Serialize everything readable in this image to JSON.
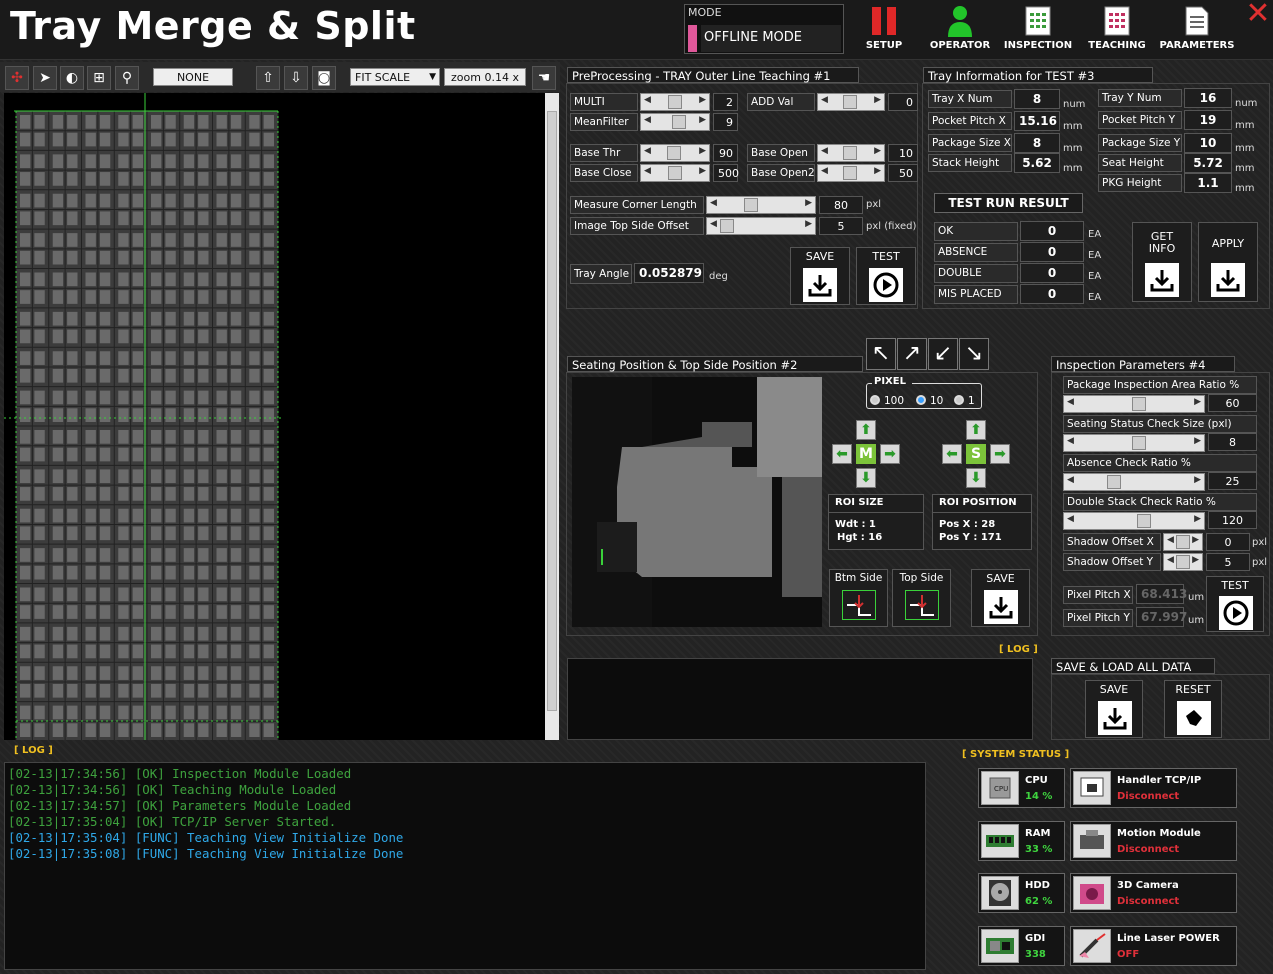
{
  "app": {
    "title": "Tray Merge & Split"
  },
  "mode": {
    "label": "MODE",
    "value": "OFFLINE MODE"
  },
  "topnav": [
    {
      "id": "setup",
      "label": "SETUP"
    },
    {
      "id": "operator",
      "label": "OPERATOR"
    },
    {
      "id": "inspection",
      "label": "INSPECTION"
    },
    {
      "id": "teaching",
      "label": "TEACHING"
    },
    {
      "id": "parameters",
      "label": "PARAMETERS"
    }
  ],
  "viewer_toolbar": {
    "roi_mode": "NONE",
    "scale_mode": "FIT SCALE",
    "zoom": "zoom 0.14 x"
  },
  "preprocessing": {
    "title": "PreProcessing - TRAY Outer Line Teaching #1",
    "multi": {
      "label": "MULTI",
      "value": "2",
      "level": 0.5
    },
    "add_val": {
      "label": "ADD Val",
      "value": "0",
      "level": 0.45
    },
    "mean_filter": {
      "label": "MeanFilter",
      "value": "9",
      "level": 0.62
    },
    "base_thr": {
      "label": "Base Thr",
      "value": "90",
      "level": 0.45
    },
    "base_open": {
      "label": "Base Open",
      "value": "10",
      "level": 0.45
    },
    "base_close": {
      "label": "Base Close",
      "value": "500",
      "level": 0.5
    },
    "base_open2": {
      "label": "Base Open2",
      "value": "50",
      "level": 0.45
    },
    "measure_corner": {
      "label": "Measure Corner Length",
      "value": "80",
      "unit": "pxl",
      "level": 0.35
    },
    "image_top_offset": {
      "label": "Image Top Side Offset",
      "value": "5",
      "unit": "pxl (fixed)",
      "level": 0.02
    },
    "tray_angle": {
      "label": "Tray Angle",
      "value": "0.052879",
      "unit": "deg"
    },
    "save_label": "SAVE",
    "test_label": "TEST"
  },
  "tray_info": {
    "title": "Tray Information for TEST #3",
    "left": [
      {
        "label": "Tray X Num",
        "value": "8",
        "unit": "num"
      },
      {
        "label": "Pocket Pitch X",
        "value": "15.16",
        "unit": "mm"
      },
      {
        "label": "Package Size X",
        "value": "8",
        "unit": "mm"
      },
      {
        "label": "Stack Height",
        "value": "5.62",
        "unit": "mm"
      }
    ],
    "right": [
      {
        "label": "Tray Y Num",
        "value": "16",
        "unit": "num"
      },
      {
        "label": "Pocket Pitch Y",
        "value": "19",
        "unit": "mm"
      },
      {
        "label": "Package Size Y",
        "value": "10",
        "unit": "mm"
      },
      {
        "label": "Seat Height",
        "value": "5.72",
        "unit": "mm"
      },
      {
        "label": "PKG Height",
        "value": "1.1",
        "unit": "mm"
      }
    ],
    "test_run_title": "TEST RUN RESULT",
    "results": [
      {
        "label": "OK",
        "value": "0",
        "unit": "EA"
      },
      {
        "label": "ABSENCE",
        "value": "0",
        "unit": "EA"
      },
      {
        "label": "DOUBLE",
        "value": "0",
        "unit": "EA"
      },
      {
        "label": "MIS PLACED",
        "value": "0",
        "unit": "EA"
      }
    ],
    "get_info_label": "GET INFO",
    "apply_label": "APPLY"
  },
  "seating": {
    "title": "Seating Position & Top Side Position #2",
    "pixel_group": "PIXEL",
    "pixel_options": [
      "100",
      "10",
      "1"
    ],
    "pixel_selected": "10",
    "m_label": "M",
    "s_label": "S",
    "roi_size_title": "ROI SIZE",
    "roi_size_w": "Wdt : 1",
    "roi_size_h": "Hgt : 16",
    "roi_pos_title": "ROI POSITION",
    "roi_pos_x": "Pos X : 28",
    "roi_pos_y": "Pos Y : 171",
    "btm_side": "Btm Side",
    "top_side": "Top Side",
    "save_label": "SAVE"
  },
  "inspection_params": {
    "title": "Inspection Parameters #4",
    "items": [
      {
        "label": "Package Inspection Area Ratio %",
        "value": "60",
        "level": 0.55
      },
      {
        "label": "Seating Status Check Size (pxl)",
        "value": "8",
        "level": 0.55
      },
      {
        "label": "Absence Check Ratio %",
        "value": "25",
        "level": 0.3
      },
      {
        "label": "Double Stack Check Ratio %",
        "value": "120",
        "level": 0.6
      }
    ],
    "shadow_x": {
      "label": "Shadow Offset X",
      "value": "0",
      "unit": "pxl",
      "level": 0.5
    },
    "shadow_y": {
      "label": "Shadow Offset Y",
      "value": "5",
      "unit": "pxl",
      "level": 0.55
    },
    "pixel_pitch_x": {
      "label": "Pixel Pitch X",
      "value": "68.413",
      "unit": "um"
    },
    "pixel_pitch_y": {
      "label": "Pixel Pitch Y",
      "value": "67.997",
      "unit": "um"
    },
    "test_label": "TEST"
  },
  "small_log_label": "[ LOG ]",
  "save_load": {
    "title": "SAVE & LOAD ALL DATA",
    "save_label": "SAVE",
    "reset_label": "RESET"
  },
  "main_log": {
    "label": "[ LOG ]",
    "lines": [
      {
        "text": "[02-13|17:34:56] [OK] Inspection Module Loaded",
        "color": "#3ea23e"
      },
      {
        "text": "[02-13|17:34:56] [OK] Teaching Module Loaded",
        "color": "#3ea23e"
      },
      {
        "text": "[02-13|17:34:57] [OK] Parameters Module Loaded",
        "color": "#3ea23e"
      },
      {
        "text": "[02-13|17:35:04] [OK] TCP/IP Server Started.",
        "color": "#3ea23e"
      },
      {
        "text": "[02-13|17:35:04] [FUNC] Teaching View Initialize Done",
        "color": "#2fa8e8"
      },
      {
        "text": "[02-13|17:35:08] [FUNC] Teaching View Initialize Done",
        "color": "#2fa8e8"
      }
    ]
  },
  "system_status": {
    "label": "[ SYSTEM STATUS ]",
    "resources": [
      {
        "name": "CPU",
        "value": "14 %",
        "icon": "cpu-icon"
      },
      {
        "name": "RAM",
        "value": "33 %",
        "icon": "ram-icon"
      },
      {
        "name": "HDD",
        "value": "62 %",
        "icon": "hdd-icon"
      },
      {
        "name": "GDI",
        "value": "338",
        "icon": "gpu-icon"
      }
    ],
    "devices": [
      {
        "name": "Handler TCP/IP",
        "state": "Disconnect",
        "icon": "network-icon"
      },
      {
        "name": "Motion Module",
        "state": "Disconnect",
        "icon": "motion-module-icon"
      },
      {
        "name": "3D Camera",
        "state": "Disconnect",
        "icon": "camera-3d-icon"
      },
      {
        "name": "Line Laser POWER",
        "state": "OFF",
        "icon": "laser-icon"
      }
    ],
    "colors": {
      "ok": "#3fd43f",
      "bad": "#e0303a"
    }
  }
}
